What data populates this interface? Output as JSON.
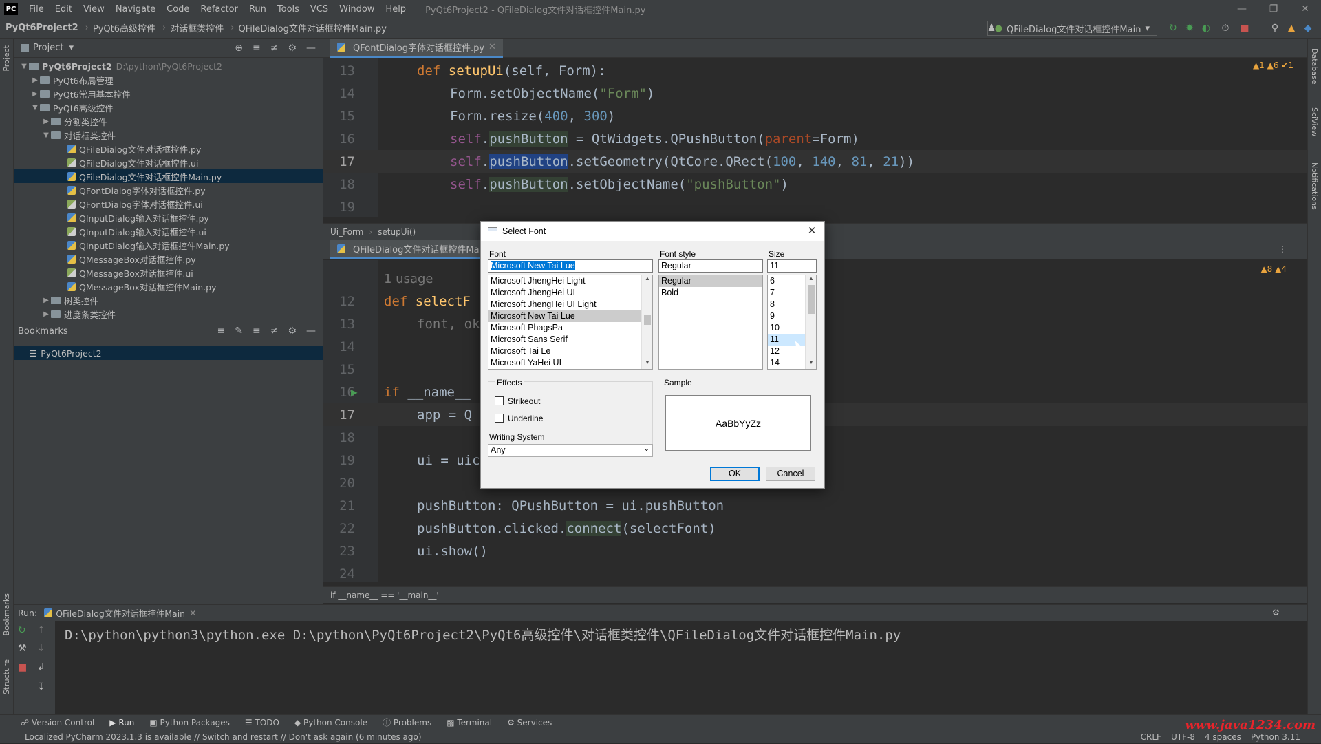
{
  "menubar": {
    "logo": "PC",
    "items": [
      "File",
      "Edit",
      "View",
      "Navigate",
      "Code",
      "Refactor",
      "Run",
      "Tools",
      "VCS",
      "Window",
      "Help"
    ],
    "title": "PyQt6Project2 - QFileDialog文件对话框控件Main.py"
  },
  "navbar": {
    "crumbs": [
      "PyQt6Project2",
      "PyQt6高级控件",
      "对话框类控件",
      "QFileDialog文件对话框控件Main.py"
    ],
    "run_config": "QFileDialog文件对话框控件Main"
  },
  "left_strip": {
    "project": "Project",
    "bookmarks": "Bookmarks",
    "structure": "Structure"
  },
  "right_strip": {
    "database": "Database",
    "sciview": "SciView",
    "notifications": "Notifications"
  },
  "project": {
    "header": "Project",
    "root": "PyQt6Project2",
    "root_path": "D:\\python\\PyQt6Project2",
    "items": [
      "PyQt6布局管理",
      "PyQt6常用基本控件",
      "PyQt6高级控件",
      "分割类控件",
      "对话框类控件",
      "QFileDialog文件对话框控件.py",
      "QFileDialog文件对话框控件.ui",
      "QFileDialog文件对话框控件Main.py",
      "QFontDialog字体对话框控件.py",
      "QFontDialog字体对话框控件.ui",
      "QInputDialog输入对话框控件.py",
      "QInputDialog输入对话框控件.ui",
      "QInputDialog输入对话框控件Main.py",
      "QMessageBox对话框控件.py",
      "QMessageBox对话框控件.ui",
      "QMessageBox对话框控件Main.py",
      "树类控件",
      "进度条类控件"
    ]
  },
  "bookmarks": {
    "header": "Bookmarks",
    "item": "PyQt6Project2"
  },
  "editor_top": {
    "tab": "QFontDialog字体对话框控件.py",
    "lines": [
      "13",
      "14",
      "15",
      "16",
      "17",
      "18",
      "19"
    ],
    "code": {
      "l13_def": "def ",
      "l13_fn": "setupUi",
      "l13_rest": "(self, Form):",
      "l14": "Form.setObjectName(",
      "l14_str": "\"Form\"",
      "l14_end": ")",
      "l15": "Form.resize(",
      "l15_a": "400",
      "l15_sep": ", ",
      "l15_b": "300",
      "l15_end": ")",
      "self": "self",
      "dot": ".",
      "pushButton": "pushButton",
      "l16_eq": " = QtWidgets.QPushButton(",
      "l16_param": "parent",
      "l16_end": "=Form)",
      "l17_a": ".setGeometry(QtCore.QRect(",
      "l17_n1": "100",
      "l17_n2": "140",
      "l17_n3": "81",
      "l17_n4": "21",
      "l17_c": ", ",
      "l17_end": "))",
      "l18_a": ".setObjectName(",
      "l18_str": "\"pushButton\"",
      "l18_end": ")"
    },
    "breadcrumb": [
      "Ui_Form",
      "setupUi()"
    ],
    "inspections": "▲1 ▲6 ✔1"
  },
  "editor_bottom": {
    "tab": "QFileDialog文件对话框控件Main.py",
    "usage": "1 usage",
    "lines": [
      "12",
      "13",
      "14",
      "15",
      "16",
      "17",
      "18",
      "19",
      "20",
      "21",
      "22",
      "23",
      "24"
    ],
    "code": {
      "l12_def": "def ",
      "l12_fn": "selectF",
      "l13": "font, ok",
      "l16_if": "if ",
      "l16_rest": "__name__",
      "l17": "app = Q",
      "l19": "ui = uic",
      "l21": "pushButton: QPushButton = ui.pushButton",
      "l22_a": "pushButton.clicked.",
      "l22_hl": "connect",
      "l22_b": "(selectFont)",
      "l23": "ui.show()"
    },
    "breadcrumb": "if __name__ == '__main__'",
    "inspections": "▲8 ▲4"
  },
  "run": {
    "label": "Run:",
    "tab": "QFileDialog文件对话框控件Main",
    "output": "D:\\python\\python3\\python.exe D:\\python\\PyQt6Project2\\PyQt6高级控件\\对话框类控件\\QFileDialog文件对话框控件Main.py"
  },
  "bottom_tabs": [
    "Version Control",
    "Run",
    "Python Packages",
    "TODO",
    "Python Console",
    "Problems",
    "Terminal",
    "Services"
  ],
  "status": {
    "message": "Localized PyCharm 2023.1.3 is available // Switch and restart // Don't ask again (6 minutes ago)",
    "right": [
      "CRLF",
      "UTF-8",
      "4 spaces",
      "Python 3.11"
    ]
  },
  "watermark": "www.java1234.com",
  "dialog": {
    "title": "Select Font",
    "font_label": "Font",
    "font_value": "Microsoft New Tai Lue",
    "fonts": [
      "Microsoft JhengHei Light",
      "Microsoft JhengHei UI",
      "Microsoft JhengHei UI Light",
      "Microsoft New Tai Lue",
      "Microsoft PhagsPa",
      "Microsoft Sans Serif",
      "Microsoft Tai Le",
      "Microsoft YaHei UI"
    ],
    "style_label": "Font style",
    "style_value": "Regular",
    "styles": [
      "Regular",
      "Bold"
    ],
    "size_label": "Size",
    "size_value": "11",
    "sizes": [
      "6",
      "7",
      "8",
      "9",
      "10",
      "11",
      "12",
      "14"
    ],
    "effects_label": "Effects",
    "strikeout": "Strikeout",
    "underline": "Underline",
    "writing_label": "Writing System",
    "writing_value": "Any",
    "sample_label": "Sample",
    "sample_text": "AaBbYyZz",
    "ok": "OK",
    "cancel": "Cancel"
  },
  "colors": {
    "accent": "#4a88c7",
    "selection": "#0d293e",
    "keyword": "#cc7832",
    "function": "#ffc66d",
    "string": "#6a8759",
    "number": "#6897bb"
  }
}
